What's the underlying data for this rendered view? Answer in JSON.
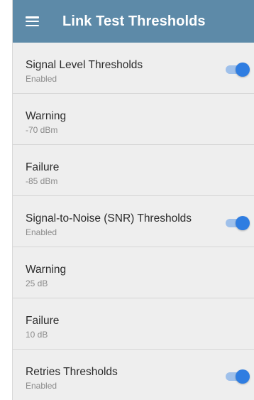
{
  "appbar": {
    "title": "Link Test Thresholds"
  },
  "settings": [
    {
      "title": "Signal Level Thresholds",
      "subtitle": "Enabled",
      "toggle": true,
      "toggle_on": true
    },
    {
      "title": "Warning",
      "subtitle": "-70 dBm",
      "toggle": false
    },
    {
      "title": "Failure",
      "subtitle": "-85 dBm",
      "toggle": false
    },
    {
      "title": "Signal-to-Noise (SNR) Thresholds",
      "subtitle": "Enabled",
      "toggle": true,
      "toggle_on": true
    },
    {
      "title": "Warning",
      "subtitle": "25 dB",
      "toggle": false
    },
    {
      "title": "Failure",
      "subtitle": "10 dB",
      "toggle": false
    },
    {
      "title": "Retries Thresholds",
      "subtitle": "Enabled",
      "toggle": true,
      "toggle_on": true
    }
  ],
  "colors": {
    "appbar": "#5d8aa8",
    "toggle_on": "#2f7de1",
    "toggle_track": "#9fc0ea"
  },
  "icons": {
    "menu": "hamburger-menu-icon"
  }
}
